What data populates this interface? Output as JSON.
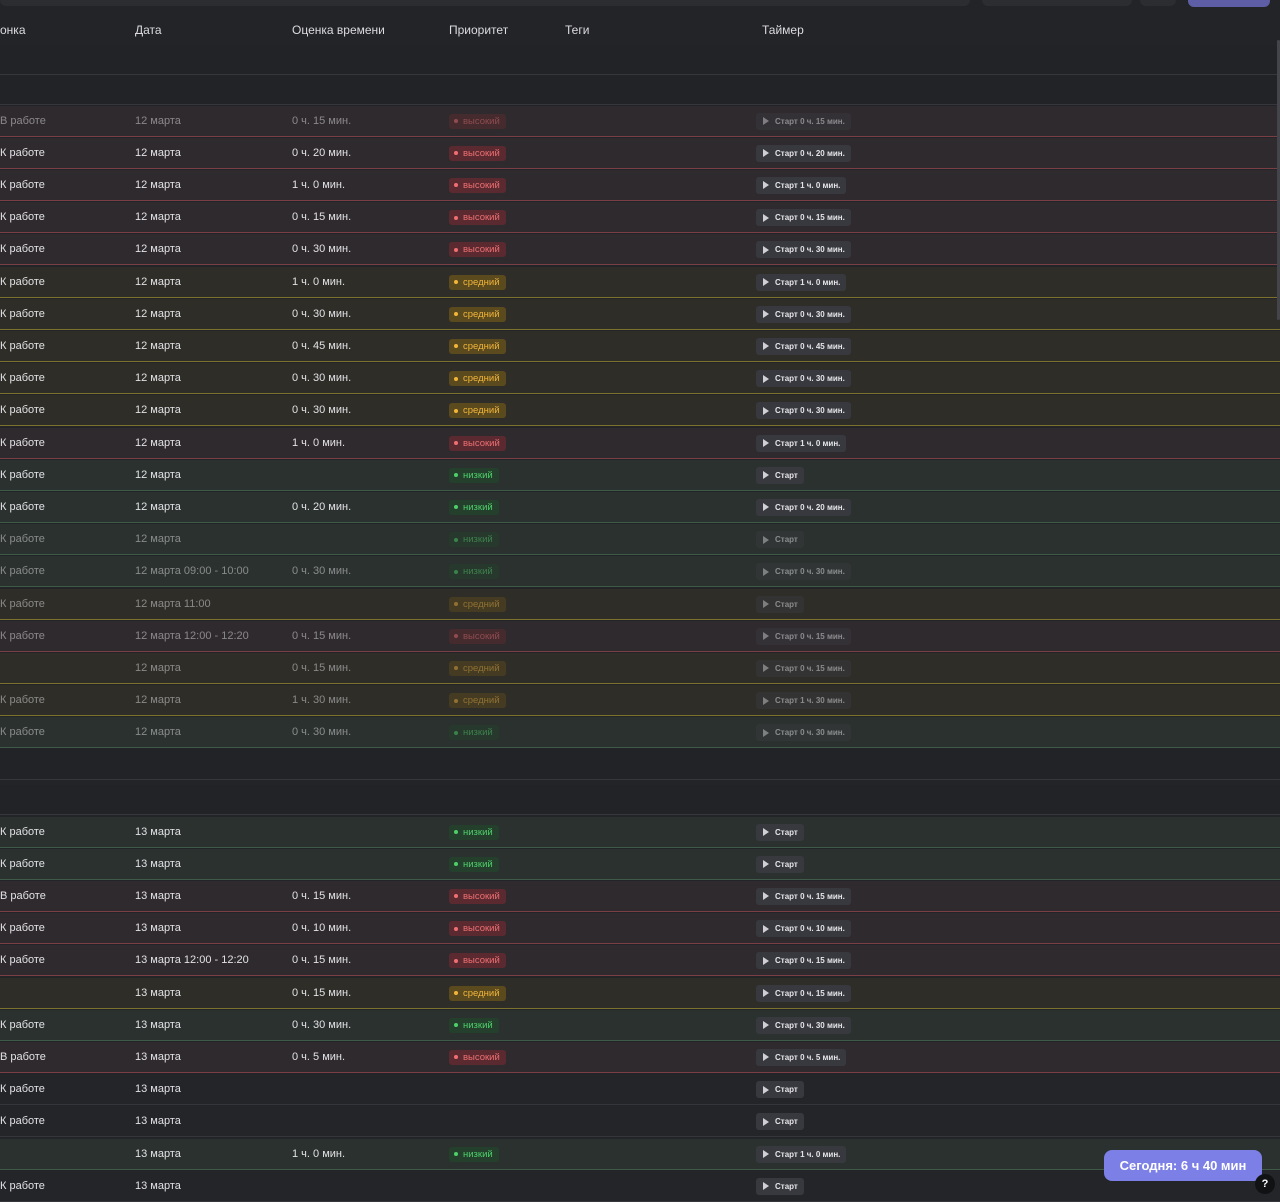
{
  "columns": {
    "status": "онка",
    "date": "Дата",
    "estimate": "Оценка времени",
    "priority": "Приоритет",
    "tags": "Теги",
    "timer": "Таймер"
  },
  "timer_prefix": "Старт",
  "priority_colors": {
    "high": "#ee6f73",
    "medium": "#f2b53a",
    "low": "#4ecf6a"
  },
  "groups": [
    {
      "rows": [
        {
          "status": "В работе",
          "date": "12 марта",
          "estimate": "0 ч. 15 мин.",
          "priority": "высокий",
          "p": "hi",
          "timer": "0 ч. 15 мин.",
          "dim": true
        },
        {
          "status": "К работе",
          "date": "12 марта",
          "estimate": "0 ч. 20 мин.",
          "priority": "высокий",
          "p": "hi",
          "timer": "0 ч. 20 мин."
        },
        {
          "status": "К работе",
          "date": "12 марта",
          "estimate": "1 ч. 0 мин.",
          "priority": "высокий",
          "p": "hi",
          "timer": "1 ч. 0 мин."
        },
        {
          "status": "К работе",
          "date": "12 марта",
          "estimate": "0 ч. 15 мин.",
          "priority": "высокий",
          "p": "hi",
          "timer": "0 ч. 15 мин."
        },
        {
          "status": "К работе",
          "date": "12 марта",
          "estimate": "0 ч. 30 мин.",
          "priority": "высокий",
          "p": "hi",
          "timer": "0 ч. 30 мин."
        },
        {
          "status": "К работе",
          "date": "12 марта",
          "estimate": "1 ч. 0 мин.",
          "priority": "средний",
          "p": "md",
          "timer": "1 ч. 0 мин."
        },
        {
          "status": "К работе",
          "date": "12 марта",
          "estimate": "0 ч. 30 мин.",
          "priority": "средний",
          "p": "md",
          "timer": "0 ч. 30 мин."
        },
        {
          "status": "К работе",
          "date": "12 марта",
          "estimate": "0 ч. 45 мин.",
          "priority": "средний",
          "p": "md",
          "timer": "0 ч. 45 мин."
        },
        {
          "status": "К работе",
          "date": "12 марта",
          "estimate": "0 ч. 30 мин.",
          "priority": "средний",
          "p": "md",
          "timer": "0 ч. 30 мин."
        },
        {
          "status": "К работе",
          "date": "12 марта",
          "estimate": "0 ч. 30 мин.",
          "priority": "средний",
          "p": "md",
          "timer": "0 ч. 30 мин."
        },
        {
          "status": "К работе",
          "date": "12 марта",
          "estimate": "1 ч. 0 мин.",
          "priority": "высокий",
          "p": "hi",
          "timer": "1 ч. 0 мин."
        },
        {
          "status": "К работе",
          "date": "12 марта",
          "estimate": "",
          "priority": "низкий",
          "p": "lo",
          "timer": ""
        },
        {
          "status": "К работе",
          "date": "12 марта",
          "estimate": "0 ч. 20 мин.",
          "priority": "низкий",
          "p": "lo",
          "timer": "0 ч. 20 мин."
        },
        {
          "status": "К работе",
          "date": "12 марта",
          "estimate": "",
          "priority": "низкий",
          "p": "lo",
          "timer": "",
          "dim": true
        },
        {
          "status": "К работе",
          "date": "12 марта 09:00 - 10:00",
          "estimate": "0 ч. 30 мин.",
          "priority": "низкий",
          "p": "lo",
          "timer": "0 ч. 30 мин.",
          "dim": true
        },
        {
          "status": "К работе",
          "date": "12 марта 11:00",
          "estimate": "",
          "priority": "средний",
          "p": "md",
          "timer": "",
          "dim": true
        },
        {
          "status": "К работе",
          "date": "12 марта 12:00 - 12:20",
          "estimate": "0 ч. 15 мин.",
          "priority": "высокий",
          "p": "hi",
          "timer": "0 ч. 15 мин.",
          "dim": true
        },
        {
          "status": "",
          "date": "12 марта",
          "estimate": "0 ч. 15 мин.",
          "priority": "средний",
          "p": "md",
          "timer": "0 ч. 15 мин.",
          "dim": true
        },
        {
          "status": "К работе",
          "date": "12 марта",
          "estimate": "1 ч. 30 мин.",
          "priority": "средний",
          "p": "md",
          "timer": "1 ч. 30 мин.",
          "dim": true
        },
        {
          "status": "К работе",
          "date": "12 марта",
          "estimate": "0 ч. 30 мин.",
          "priority": "низкий",
          "p": "lo",
          "timer": "0 ч. 30 мин.",
          "dim": true
        }
      ]
    },
    {
      "rows": [
        {
          "status": "К работе",
          "date": "13 марта",
          "estimate": "",
          "priority": "низкий",
          "p": "lo",
          "timer": ""
        },
        {
          "status": "К работе",
          "date": "13 марта",
          "estimate": "",
          "priority": "низкий",
          "p": "lo",
          "timer": ""
        },
        {
          "status": "В работе",
          "date": "13 марта",
          "estimate": "0 ч. 15 мин.",
          "priority": "высокий",
          "p": "hi",
          "timer": "0 ч. 15 мин."
        },
        {
          "status": "К работе",
          "date": "13 марта",
          "estimate": "0 ч. 10 мин.",
          "priority": "высокий",
          "p": "hi",
          "timer": "0 ч. 10 мин."
        },
        {
          "status": "К работе",
          "date": "13 марта 12:00 - 12:20",
          "estimate": "0 ч. 15 мин.",
          "priority": "высокий",
          "p": "hi",
          "timer": "0 ч. 15 мин."
        },
        {
          "status": "",
          "date": "13 марта",
          "estimate": "0 ч. 15 мин.",
          "priority": "средний",
          "p": "md",
          "timer": "0 ч. 15 мин."
        },
        {
          "status": "К работе",
          "date": "13 марта",
          "estimate": "0 ч. 30 мин.",
          "priority": "низкий",
          "p": "lo",
          "timer": "0 ч. 30 мин."
        },
        {
          "status": "В работе",
          "date": "13 марта",
          "estimate": "0 ч. 5 мин.",
          "priority": "высокий",
          "p": "hi",
          "timer": "0 ч. 5 мин."
        },
        {
          "status": "К работе",
          "date": "13 марта",
          "estimate": "",
          "priority": "",
          "p": "no",
          "timer": ""
        },
        {
          "status": "К работе",
          "date": "13 марта",
          "estimate": "",
          "priority": "",
          "p": "no",
          "timer": ""
        },
        {
          "status": "",
          "date": "13 марта",
          "estimate": "1 ч. 0 мин.",
          "priority": "низкий",
          "p": "lo",
          "timer": "1 ч. 0 мин."
        },
        {
          "status": "К работе",
          "date": "13 марта",
          "estimate": "",
          "priority": "",
          "p": "no",
          "timer": ""
        }
      ]
    }
  ],
  "today_badge": "Сегодня: 6 ч 40 мин",
  "help_label": "?"
}
